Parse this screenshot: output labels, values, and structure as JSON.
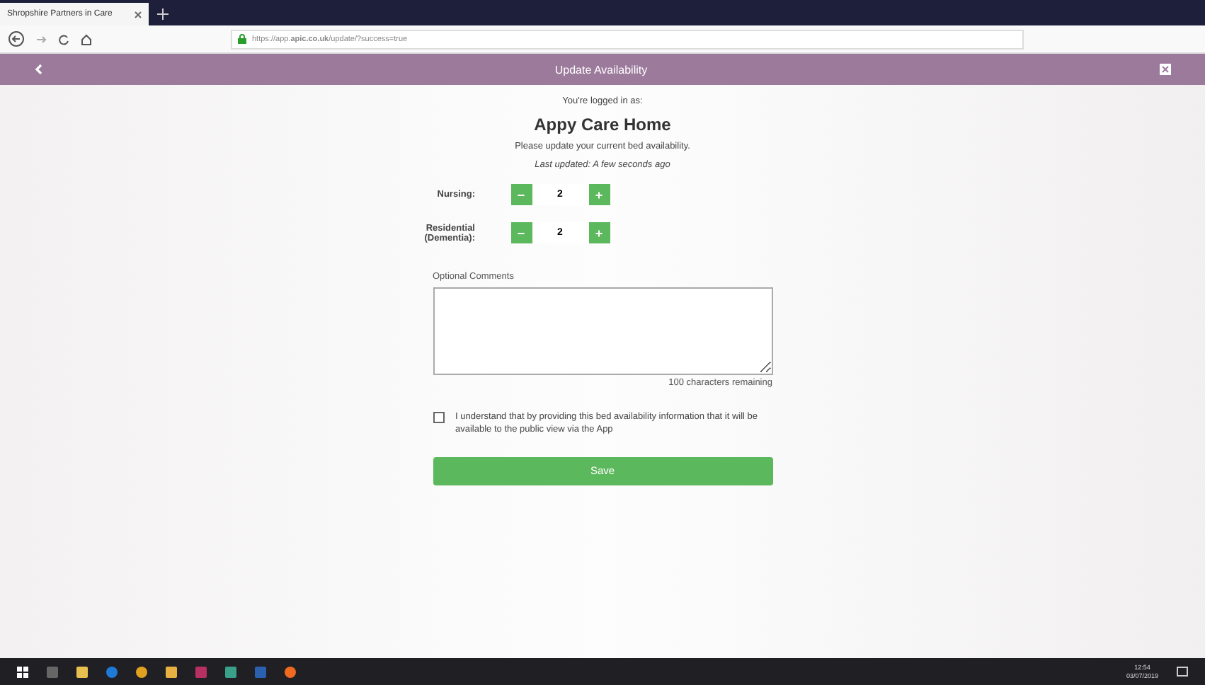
{
  "browser": {
    "tab_title": "Shropshire Partners in Care",
    "url": "https://app.**apic.co.uk**/update/?success=true"
  },
  "header": {
    "title": "Update Availability"
  },
  "intro": {
    "logged_in_label": "You're logged in as:",
    "home_name": "Appy Care Home",
    "instruction": "Please update your current bed availability.",
    "last_updated": "Last updated: A few seconds ago"
  },
  "counters": [
    {
      "label": "Nursing:",
      "value": "2",
      "minus": "−",
      "plus": "+"
    },
    {
      "label": "Residential (Dementia):",
      "value": "2",
      "minus": "−",
      "plus": "+"
    }
  ],
  "comments": {
    "label": "Optional Comments",
    "remaining": "100 characters remaining"
  },
  "consent": {
    "checked": false,
    "text": "I understand that by providing this bed availability information that it will be available to the public view via the App"
  },
  "save_button": "Save",
  "taskbar": {
    "time": "12:54",
    "date": "03/07/2019"
  }
}
